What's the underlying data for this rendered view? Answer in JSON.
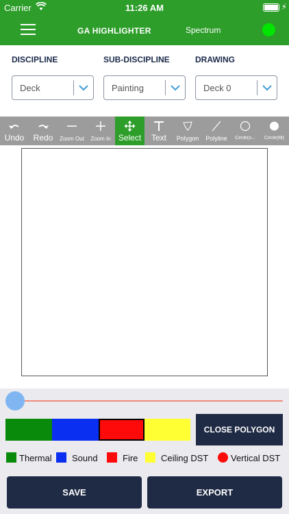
{
  "status_bar": {
    "carrier": "Carrier",
    "time": "11:26 AM"
  },
  "nav": {
    "title": "GA HIGHLIGHTER",
    "spectrum": "Spectrum",
    "status_color": "#00e600"
  },
  "selectors": [
    {
      "label": "DISCIPLINE",
      "value": "Deck"
    },
    {
      "label": "SUB-DISCIPLINE",
      "value": "Painting"
    },
    {
      "label": "DRAWING",
      "value": "Deck 0"
    }
  ],
  "tools": [
    {
      "label": "Undo",
      "icon": "undo-icon"
    },
    {
      "label": "Redo",
      "icon": "redo-icon"
    },
    {
      "label": "Zoom Out",
      "icon": "minus-icon"
    },
    {
      "label": "Zoom In",
      "icon": "plus-icon"
    },
    {
      "label": "Select",
      "icon": "move-icon",
      "active": true
    },
    {
      "label": "Text",
      "icon": "text-icon"
    },
    {
      "label": "Polygon",
      "icon": "polygon-icon"
    },
    {
      "label": "Polyline",
      "icon": "line-icon"
    },
    {
      "label": "Circle(o...",
      "icon": "circle-outline-icon"
    },
    {
      "label": "Circle(fill)",
      "icon": "circle-fill-icon"
    }
  ],
  "slider": {
    "value": 0
  },
  "swatches": [
    {
      "color": "#0a8a0a"
    },
    {
      "color": "#0a2ff0"
    },
    {
      "color": "#ff0a0a",
      "selected": true
    },
    {
      "color": "#ffff33"
    }
  ],
  "close_polygon_label": "CLOSE POLYGON",
  "legend": [
    {
      "label": "Thermal",
      "color": "#0a8a0a",
      "shape": "square"
    },
    {
      "label": "Sound",
      "color": "#0a2ff0",
      "shape": "square"
    },
    {
      "label": "Fire",
      "color": "#ff0a0a",
      "shape": "square"
    },
    {
      "label": "Ceiling DST",
      "color": "#ffff33",
      "shape": "square"
    },
    {
      "label": "Vertical DST",
      "color": "#ff0a0a",
      "shape": "circle"
    }
  ],
  "actions": {
    "save": "SAVE",
    "export": "EXPORT"
  },
  "colors": {
    "brand_green": "#2e9e2b",
    "navy": "#1f2a44",
    "toolbar_gray": "#9c9c9c"
  }
}
